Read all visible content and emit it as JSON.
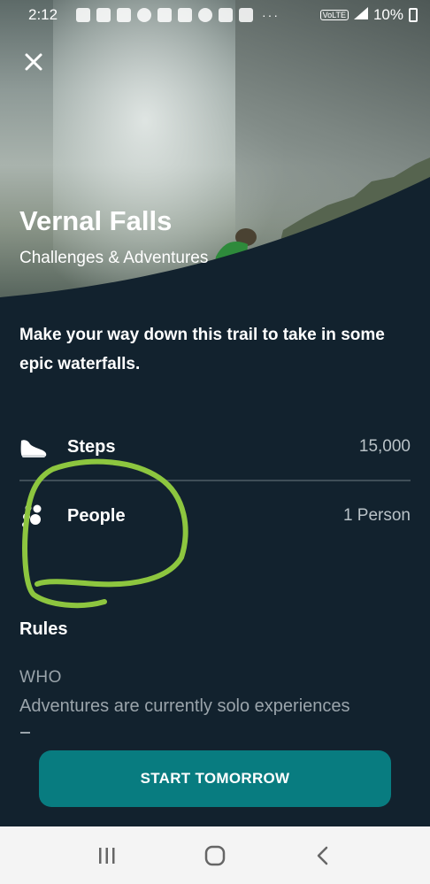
{
  "status_bar": {
    "time": "2:12",
    "battery": "10%",
    "network": "VoLTE",
    "icons": [
      "message-icon",
      "tiktok-icon",
      "tiktok-icon",
      "pinterest-icon",
      "flipboard-icon",
      "trophy-icon",
      "chrome-icon",
      "pinwheel-icon",
      "youtube-icon"
    ],
    "overflow": "···"
  },
  "header": {
    "title": "Vernal Falls",
    "subtitle": "Challenges & Adventures",
    "close_icon": "close-icon"
  },
  "description": "Make your way down this trail to take in some epic waterfalls.",
  "stats": [
    {
      "label": "Steps",
      "value": "15,000",
      "icon": "shoe-icon"
    },
    {
      "label": "People",
      "value": "1 Person",
      "icon": "people-icon"
    }
  ],
  "rules": {
    "title": "Rules",
    "who_label": "WHO",
    "who_text": "Adventures are currently solo experiences"
  },
  "cta": {
    "label": "START TOMORROW"
  },
  "nav": {
    "icons": [
      "recent-apps-icon",
      "home-icon",
      "back-icon"
    ]
  },
  "colors": {
    "background": "#12222e",
    "accent": "#087c80",
    "annotation": "#8dc63f"
  }
}
